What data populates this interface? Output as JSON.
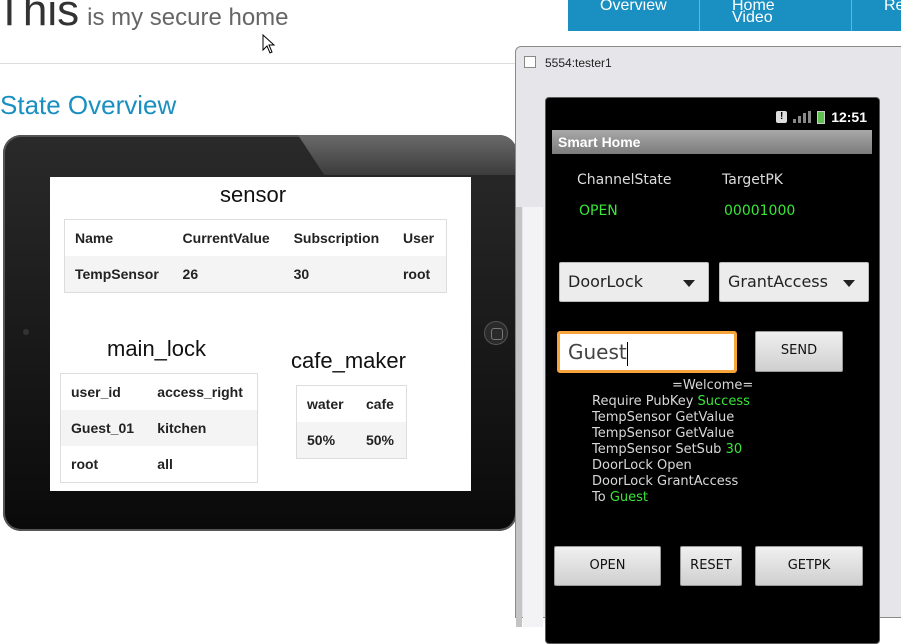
{
  "page": {
    "title_big": "This",
    "title_small": "is my secure home",
    "nav": [
      "Overview",
      "Home Video",
      "Re"
    ],
    "section_heading": "State Overview"
  },
  "tablet": {
    "sensor": {
      "title": "sensor",
      "headers": [
        "Name",
        "CurrentValue",
        "Subscription",
        "User"
      ],
      "rows": [
        [
          "TempSensor",
          "26",
          "30",
          "root"
        ]
      ]
    },
    "main_lock": {
      "title": "main_lock",
      "headers": [
        "user_id",
        "access_right"
      ],
      "rows": [
        [
          "Guest_01",
          "kitchen"
        ],
        [
          "root",
          "all"
        ]
      ]
    },
    "cafe_maker": {
      "title": "cafe_maker",
      "headers": [
        "water",
        "cafe"
      ],
      "rows": [
        [
          "50%",
          "50%"
        ]
      ]
    }
  },
  "emulator": {
    "window_title": "5554:tester1",
    "status_time": "12:51",
    "app_title": "Smart Home",
    "channel_state_label": "ChannelState",
    "target_pk_label": "TargetPK",
    "channel_state_value": "OPEN",
    "target_pk_value": "00001000",
    "device_spinner": "DoorLock",
    "action_spinner": "GrantAccess",
    "input_value": "Guest",
    "send_label": "SEND",
    "log": {
      "welcome": "=Welcome=",
      "l1_prefix": "Require PubKey ",
      "l1_value": "Success",
      "l2": "TempSensor GetValue",
      "l3": "TempSensor GetValue",
      "l4_prefix": "TempSensor SetSub ",
      "l4_value": "30",
      "l5": "DoorLock Open",
      "l6": "DoorLock GrantAccess",
      "l7_prefix": "To ",
      "l7_value": "Guest"
    },
    "buttons": {
      "open": "OPEN",
      "reset": "RESET",
      "getpk": "GETPK"
    },
    "accent_green": "#39e639",
    "input_focus_color": "#f7a53a"
  }
}
